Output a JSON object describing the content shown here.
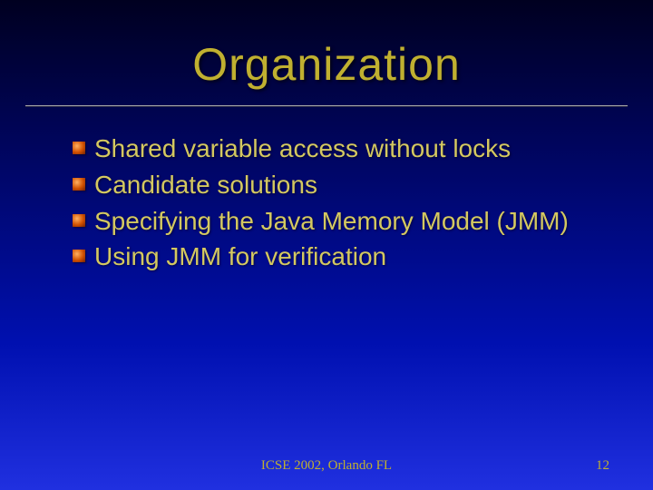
{
  "title": "Organization",
  "bullets": [
    "Shared variable access without locks",
    "Candidate solutions",
    "Specifying the Java Memory Model (JMM)",
    "Using JMM for verification"
  ],
  "footer": {
    "venue": "ICSE 2002, Orlando FL",
    "page": "12"
  }
}
